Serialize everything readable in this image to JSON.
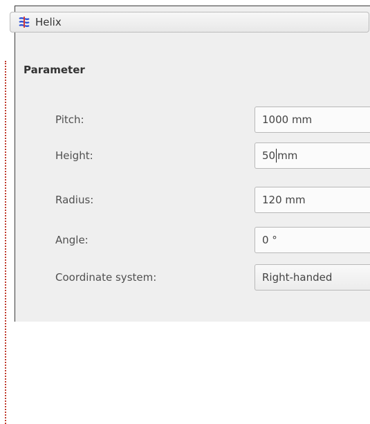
{
  "header": {
    "title": "Helix",
    "icon": "helix-icon"
  },
  "section": {
    "title": "Parameter"
  },
  "fields": [
    {
      "label": "Pitch:",
      "value": "1000 mm"
    },
    {
      "label": "Height:",
      "value_before_caret": "50",
      "value_after_caret": "mm"
    },
    {
      "label": "Radius:",
      "value": "120 mm"
    },
    {
      "label": "Angle:",
      "value": "0 °"
    },
    {
      "label": "Coordinate system:",
      "value": "Right-handed"
    }
  ],
  "colors": {
    "panel_bg": "#efefef",
    "field_bg": "#fbfbfb",
    "icon_blue": "#2b4fd8",
    "icon_red": "#d23a3a"
  }
}
